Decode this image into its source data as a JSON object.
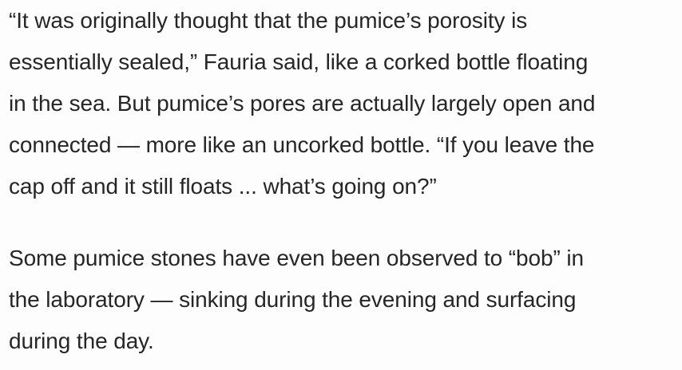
{
  "article": {
    "paragraphs": [
      {
        "lines": [
          "“It was originally thought that the pumice’s porosity is",
          "essentially sealed,” Fauria said, like a corked bottle floating",
          "in the sea. But pumice’s pores are actually largely open and",
          "connected — more like an uncorked bottle. “If you leave the",
          "cap off and it still floats ... what’s going on?”"
        ]
      },
      {
        "lines": [
          "Some pumice stones have even been observed to “bob” in",
          "the laboratory — sinking during the evening and surfacing",
          "during the day."
        ]
      }
    ]
  }
}
